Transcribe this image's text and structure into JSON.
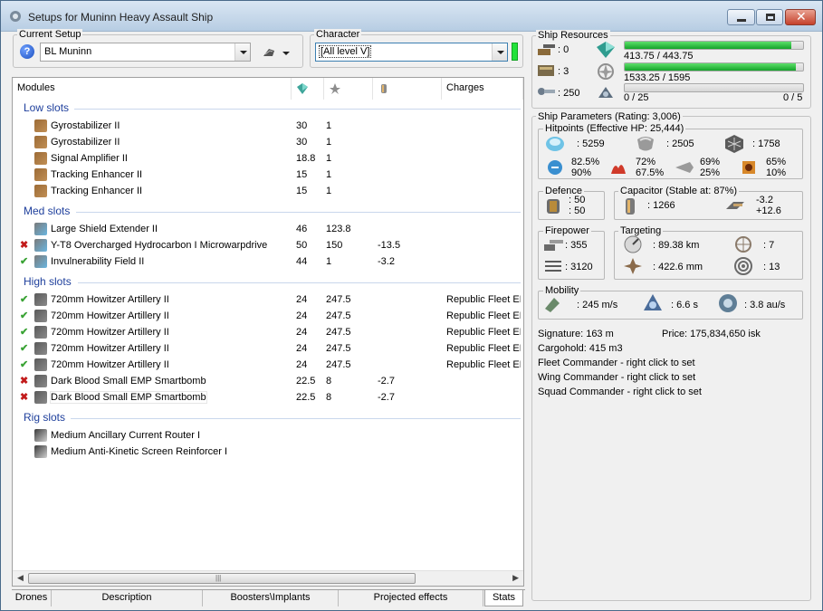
{
  "window": {
    "title": "Setups for Muninn Heavy Assault Ship"
  },
  "setup": {
    "label": "Current Setup",
    "value": "BL Muninn"
  },
  "character": {
    "label": "Character",
    "value": "[All level V]"
  },
  "modules": {
    "headers": {
      "modules": "Modules",
      "charges": "Charges"
    },
    "sections": {
      "low": "Low slots",
      "med": "Med slots",
      "high": "High slots",
      "rig": "Rig slots"
    },
    "low": [
      {
        "status": "",
        "name": "Gyrostabilizer II",
        "cpu": "30",
        "pg": "1",
        "cap": "",
        "charge": ""
      },
      {
        "status": "",
        "name": "Gyrostabilizer II",
        "cpu": "30",
        "pg": "1",
        "cap": "",
        "charge": ""
      },
      {
        "status": "",
        "name": "Signal Amplifier II",
        "cpu": "18.8",
        "pg": "1",
        "cap": "",
        "charge": ""
      },
      {
        "status": "",
        "name": "Tracking Enhancer II",
        "cpu": "15",
        "pg": "1",
        "cap": "",
        "charge": ""
      },
      {
        "status": "",
        "name": "Tracking Enhancer II",
        "cpu": "15",
        "pg": "1",
        "cap": "",
        "charge": ""
      }
    ],
    "med": [
      {
        "status": "",
        "name": "Large Shield Extender II",
        "cpu": "46",
        "pg": "123.8",
        "cap": "",
        "charge": ""
      },
      {
        "status": "✖",
        "name": "Y-T8 Overcharged Hydrocarbon I Microwarpdrive",
        "cpu": "50",
        "pg": "150",
        "cap": "-13.5",
        "charge": ""
      },
      {
        "status": "✔",
        "name": "Invulnerability Field II",
        "cpu": "44",
        "pg": "1",
        "cap": "-3.2",
        "charge": ""
      }
    ],
    "high": [
      {
        "status": "✔",
        "name": "720mm Howitzer Artillery II",
        "cpu": "24",
        "pg": "247.5",
        "cap": "",
        "charge": "Republic Fleet EMP"
      },
      {
        "status": "✔",
        "name": "720mm Howitzer Artillery II",
        "cpu": "24",
        "pg": "247.5",
        "cap": "",
        "charge": "Republic Fleet EMP"
      },
      {
        "status": "✔",
        "name": "720mm Howitzer Artillery II",
        "cpu": "24",
        "pg": "247.5",
        "cap": "",
        "charge": "Republic Fleet EMP"
      },
      {
        "status": "✔",
        "name": "720mm Howitzer Artillery II",
        "cpu": "24",
        "pg": "247.5",
        "cap": "",
        "charge": "Republic Fleet EMP"
      },
      {
        "status": "✔",
        "name": "720mm Howitzer Artillery II",
        "cpu": "24",
        "pg": "247.5",
        "cap": "",
        "charge": "Republic Fleet EMP"
      },
      {
        "status": "✖",
        "name": "Dark Blood Small EMP Smartbomb",
        "cpu": "22.5",
        "pg": "8",
        "cap": "-2.7",
        "charge": ""
      },
      {
        "status": "✖",
        "name": "Dark Blood Small EMP Smartbomb",
        "cpu": "22.5",
        "pg": "8",
        "cap": "-2.7",
        "charge": ""
      }
    ],
    "rig": [
      {
        "status": "",
        "name": "Medium Ancillary Current Router I",
        "cpu": "",
        "pg": "",
        "cap": "",
        "charge": ""
      },
      {
        "status": "",
        "name": "Medium Anti-Kinetic Screen Reinforcer I",
        "cpu": "",
        "pg": "",
        "cap": "",
        "charge": ""
      }
    ]
  },
  "tabs": [
    "Drones",
    "Description",
    "Boosters\\Implants",
    "Projected effects",
    "Stats"
  ],
  "resources": {
    "label": "Ship Resources",
    "turrets": ": 0",
    "launchers": ": 3",
    "drone_bw": ": 250",
    "cpu_text": "413.75 / 443.75",
    "cpu_fraction": 0.932,
    "pg_text": "1533.25 / 1595",
    "pg_fraction": 0.961,
    "drone_bay_text": "0 / 25",
    "drones_active": "0 / 5",
    "drone_fraction": 0
  },
  "params": {
    "label": "Ship Parameters (Rating: 3,006)",
    "hp_label": "Hitpoints (Effective HP: 25,444)",
    "shield_hp": ": 5259",
    "armor_hp": ": 2505",
    "structure_hp": ": 1758",
    "resist_em": [
      "82.5%",
      "90%"
    ],
    "resist_thermal": [
      "72%",
      "67.5%"
    ],
    "resist_kinetic": [
      "69%",
      "25%"
    ],
    "resist_explosive": [
      "65%",
      "10%"
    ],
    "defence_label": "Defence",
    "defence": [
      ": 50",
      ": 50"
    ],
    "capacitor_label": "Capacitor (Stable at: 87%)",
    "cap_amount": ": 1266",
    "cap_delta": [
      "-3.2",
      "+12.6"
    ],
    "firepower_label": "Firepower",
    "dps": ": 355",
    "volley": ": 3120",
    "targeting_label": "Targeting",
    "target_range": ": 89.38 km",
    "max_targets": ": 7",
    "scan_res": ": 422.6 mm",
    "sensor_strength": ": 13",
    "mobility_label": "Mobility",
    "speed": ": 245 m/s",
    "align": ": 6.6 s",
    "warp": ": 3.8 au/s",
    "signature": "Signature: 163 m",
    "price": "Price: 175,834,650 isk",
    "cargo": "Cargohold: 415 m3",
    "fleet": "Fleet Commander - right click to set",
    "wing": "Wing Commander - right click to set",
    "squad": "Squad Commander - right click to set"
  }
}
